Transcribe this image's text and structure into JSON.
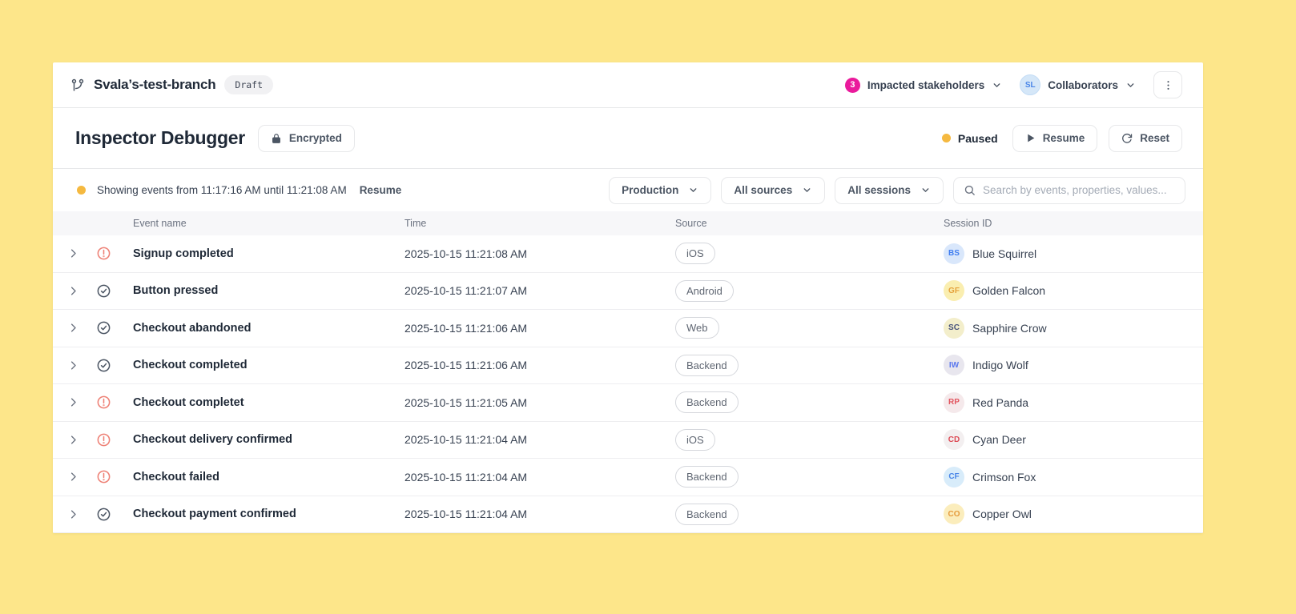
{
  "header": {
    "branch_name": "Svala’s-test-branch",
    "status_badge": "Draft",
    "impacted_stakeholders": {
      "count": "3",
      "label": "Impacted stakeholders"
    },
    "collaborators": {
      "avatar_initials": "SL",
      "label": "Collaborators"
    }
  },
  "toolbar": {
    "title": "Inspector Debugger",
    "encrypted_label": "Encrypted",
    "paused_label": "Paused",
    "resume_label": "Resume",
    "reset_label": "Reset"
  },
  "filter_bar": {
    "status_text": "Showing events from 11:17:16 AM until 11:21:08 AM",
    "resume_link": "Resume",
    "environment": "Production",
    "sources": "All sources",
    "sessions": "All sessions",
    "search_placeholder": "Search by events, properties, values..."
  },
  "table": {
    "columns": [
      "Event name",
      "Time",
      "Source",
      "Session ID"
    ],
    "rows": [
      {
        "status": "error",
        "event": "Signup completed",
        "time": "2025-10-15 11:21:08 AM",
        "source": "iOS",
        "session_initials": "BS",
        "session_name": "Blue Squirrel",
        "avatar_bg": "#d9e7fb",
        "avatar_fg": "#3f7df0"
      },
      {
        "status": "ok",
        "event": "Button pressed",
        "time": "2025-10-15 11:21:07 AM",
        "source": "Android",
        "session_initials": "GF",
        "session_name": "Golden Falcon",
        "avatar_bg": "#faeeb0",
        "avatar_fg": "#e5a23c"
      },
      {
        "status": "ok",
        "event": "Checkout abandoned",
        "time": "2025-10-15 11:21:06 AM",
        "source": "Web",
        "session_initials": "SC",
        "session_name": "Sapphire Crow",
        "avatar_bg": "#f3eecb",
        "avatar_fg": "#47537c"
      },
      {
        "status": "ok",
        "event": "Checkout completed",
        "time": "2025-10-15 11:21:06 AM",
        "source": "Backend",
        "session_initials": "IW",
        "session_name": "Indigo Wolf",
        "avatar_bg": "#e8e6ee",
        "avatar_fg": "#5b78ee"
      },
      {
        "status": "error",
        "event": "Checkout completet",
        "time": "2025-10-15 11:21:05 AM",
        "source": "Backend",
        "session_initials": "RP",
        "session_name": "Red Panda",
        "avatar_bg": "#f5e9eb",
        "avatar_fg": "#e2555f"
      },
      {
        "status": "error",
        "event": "Checkout delivery confirmed",
        "time": "2025-10-15 11:21:04 AM",
        "source": "iOS",
        "session_initials": "CD",
        "session_name": "Cyan Deer",
        "avatar_bg": "#f3eff0",
        "avatar_fg": "#dd4a55"
      },
      {
        "status": "error",
        "event": "Checkout failed",
        "time": "2025-10-15 11:21:04 AM",
        "source": "Backend",
        "session_initials": "CF",
        "session_name": "Crimson Fox",
        "avatar_bg": "#d8ecfa",
        "avatar_fg": "#4a86e8"
      },
      {
        "status": "ok",
        "event": "Checkout payment confirmed",
        "time": "2025-10-15 11:21:04 AM",
        "source": "Backend",
        "session_initials": "CO",
        "session_name": "Copper Owl",
        "avatar_bg": "#fbedbc",
        "avatar_fg": "#e59b3c"
      }
    ]
  },
  "colors": {
    "page_bg": "#fde68a",
    "card_bg": "#ffffff",
    "accent_pink": "#ea1a9c",
    "paused_orange": "#f5b940",
    "error_red": "#ee8176",
    "success_gray": "#4a5462",
    "border": "#e7e8ea",
    "thead_bg": "#f7f7f9",
    "text_dark": "#1f2937"
  },
  "icons": {
    "git_branch": "git-branch-icon",
    "chevron_down": "chevron-down-icon",
    "chevron_right": "chevron-right-icon",
    "kebab": "kebab-menu-icon",
    "lock": "lock-icon",
    "play": "play-icon",
    "reset": "reset-icon",
    "search": "search-icon",
    "error": "alert-circle-icon",
    "success": "check-circle-icon"
  }
}
